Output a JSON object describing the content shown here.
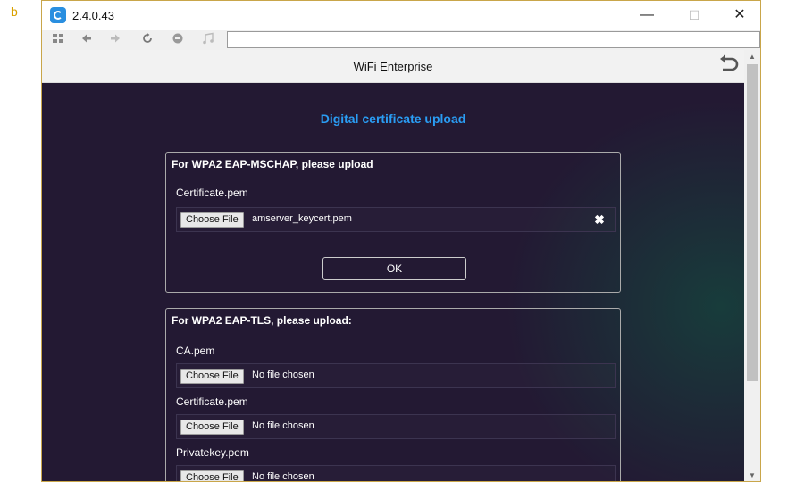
{
  "panel_letter": "b",
  "window": {
    "title": "2.4.0.43",
    "controls": {
      "minimize": "—",
      "maximize": "☐",
      "close": "✕"
    }
  },
  "toolbar": {
    "address_value": "",
    "icons": [
      "grid-icon",
      "back-arrow-icon",
      "forward-arrow-icon",
      "refresh-icon",
      "stop-icon",
      "music-icon"
    ]
  },
  "page": {
    "title": "WiFi Enterprise",
    "heading": "Digital certificate upload"
  },
  "mschap": {
    "title": "For WPA2 EAP-MSCHAP, please upload",
    "cert_label": "Certificate.pem",
    "choose_label": "Choose File",
    "file_name": "amserver_keycert.pem",
    "ok_label": "OK"
  },
  "tls": {
    "title": "For WPA2 EAP-TLS, please upload:",
    "fields": [
      {
        "label": "CA.pem",
        "choose_label": "Choose File",
        "file_name": "No file chosen"
      },
      {
        "label": "Certificate.pem",
        "choose_label": "Choose File",
        "file_name": "No file chosen"
      },
      {
        "label": "Privatekey.pem",
        "choose_label": "Choose File",
        "file_name": "No file chosen"
      }
    ]
  },
  "colors": {
    "heading": "#2a9df4",
    "background": "#231933",
    "accent_glow": "#14483e"
  }
}
